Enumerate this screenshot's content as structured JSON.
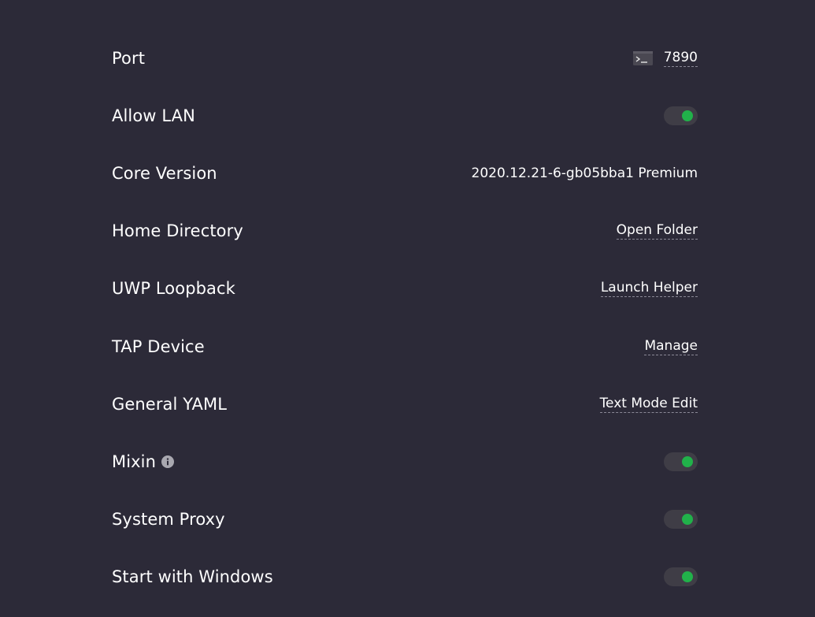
{
  "colors": {
    "background": "#2c2a38",
    "toggle_track": "#3f3d46",
    "toggle_on": "#21b14a",
    "text": "#ffffff"
  },
  "settings": {
    "port": {
      "label": "Port",
      "value": "7890",
      "icon": "terminal-icon"
    },
    "allow_lan": {
      "label": "Allow LAN",
      "enabled": true
    },
    "core_version": {
      "label": "Core Version",
      "value": "2020.12.21-6-gb05bba1 Premium"
    },
    "home_directory": {
      "label": "Home Directory",
      "action": "Open Folder"
    },
    "uwp_loopback": {
      "label": "UWP Loopback",
      "action": "Launch Helper"
    },
    "tap_device": {
      "label": "TAP Device",
      "action": "Manage"
    },
    "general_yaml": {
      "label": "General YAML",
      "action": "Text Mode Edit"
    },
    "mixin": {
      "label": "Mixin",
      "icon": "info-icon",
      "enabled": true
    },
    "system_proxy": {
      "label": "System Proxy",
      "enabled": true
    },
    "start_with_windows": {
      "label": "Start with Windows",
      "enabled": true
    }
  }
}
